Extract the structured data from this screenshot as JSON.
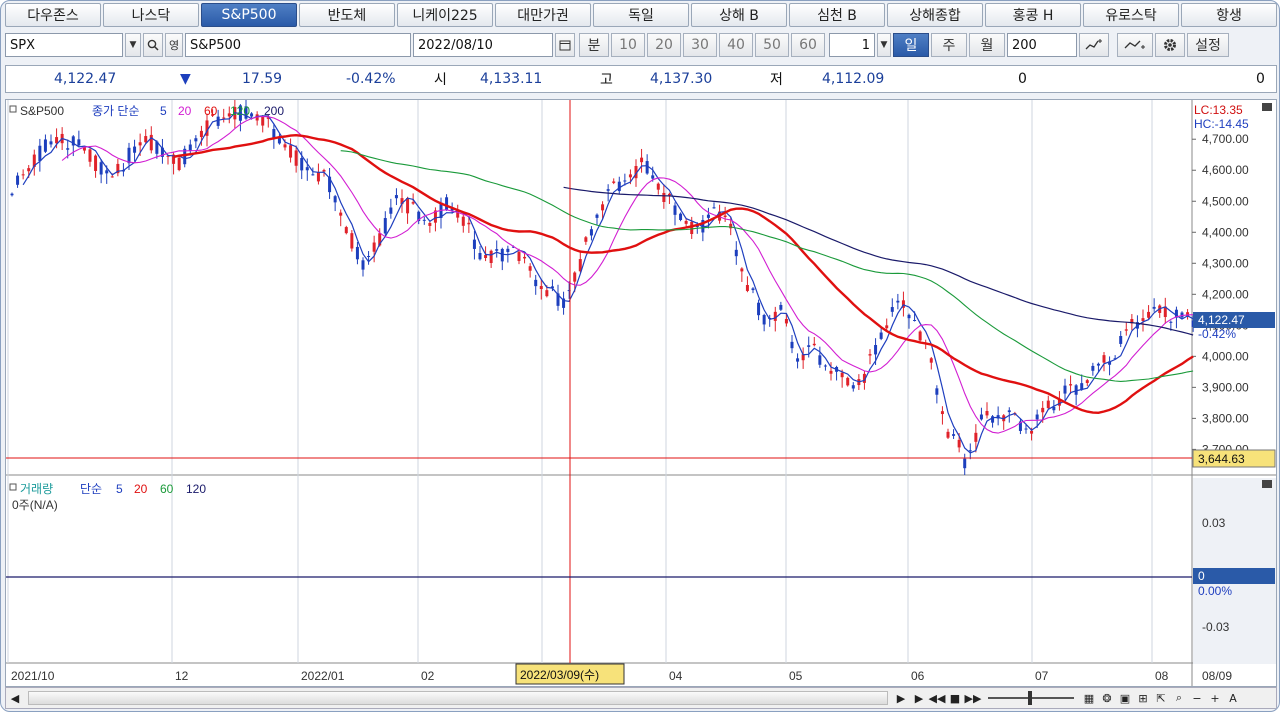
{
  "tabs": [
    {
      "label": "다우존스"
    },
    {
      "label": "나스닥"
    },
    {
      "label": "S&P500",
      "active": true
    },
    {
      "label": "반도체"
    },
    {
      "label": "니케이225"
    },
    {
      "label": "대만가권"
    },
    {
      "label": "독일"
    },
    {
      "label": "상해 B"
    },
    {
      "label": "심천 B"
    },
    {
      "label": "상해종합"
    },
    {
      "label": "홍콩 H"
    },
    {
      "label": "유로스탁"
    },
    {
      "label": "항생"
    }
  ],
  "toolbar": {
    "symbol": "SPX",
    "name": "S&P500",
    "date": "2022/08/10",
    "minute_label": "분",
    "minute_options": [
      "10",
      "20",
      "30",
      "40",
      "50",
      "60"
    ],
    "unit_value": "1",
    "day_label": "일",
    "week_label": "주",
    "month_label": "월",
    "count_value": "200",
    "settings_label": "설정",
    "period_icon": "영"
  },
  "quote": {
    "last": "4,122.47",
    "change_dir": "▼",
    "change": "17.59",
    "change_pct": "-0.42%",
    "open_label": "시",
    "open": "4,133.11",
    "high_label": "고",
    "high": "4,137.30",
    "low_label": "저",
    "low": "4,112.09",
    "volume": "0",
    "amount": "0"
  },
  "price_panel": {
    "legend_name": "S&P500",
    "legend_type": "종가 단순",
    "ma": [
      {
        "period": "5",
        "color": "#1f3fbf"
      },
      {
        "period": "20",
        "color": "#d21fd2"
      },
      {
        "period": "60",
        "color": "#e01010"
      },
      {
        "period": "120",
        "color": "#1a9a3a"
      },
      {
        "period": "200",
        "color": "#1a1a6a"
      }
    ],
    "lc": "LC:13.35",
    "hc": "HC:-14.45",
    "last_tag": "4,122.47",
    "last_pct": "-0.42%",
    "low_tag": "3,644.63"
  },
  "volume_panel": {
    "legend_name": "거래량",
    "legend_type": "단순",
    "ma": [
      {
        "period": "5",
        "color": "#1f3fbf"
      },
      {
        "period": "20",
        "color": "#e01010"
      },
      {
        "period": "60",
        "color": "#1a9a3a"
      },
      {
        "period": "120",
        "color": "#1a1a6a"
      }
    ],
    "status": "0주(N/A)",
    "tag_value": "0",
    "tag_pct": "0.00%"
  },
  "crosshair_date": "2022/03/09(수)",
  "right_date": "08/09",
  "colors": {
    "up": "#e0222a",
    "down": "#1d3fbd",
    "accent": "#2a5aa8"
  },
  "chart_data": [
    {
      "type": "candlestick",
      "y_ticks": [
        "4,700.00",
        "4,600.00",
        "4,500.00",
        "4,400.00",
        "4,300.00",
        "4,200.00",
        "4,100.00",
        "4,000.00",
        "3,900.00",
        "3,800.00",
        "3,700.00"
      ],
      "ylim": [
        3640,
        4820
      ],
      "x_ticks": [
        "2021/10",
        "12",
        "2022/01",
        "02",
        "03",
        "04",
        "05",
        "06",
        "07",
        "08"
      ],
      "series": [
        {
          "name": "종가",
          "close_path": [
            4550,
            4600,
            4680,
            4700,
            4690,
            4620,
            4580,
            4650,
            4700,
            4660,
            4620,
            4700,
            4750,
            4780,
            4790,
            4760,
            4700,
            4640,
            4590,
            4560,
            4410,
            4300,
            4380,
            4520,
            4470,
            4430,
            4500,
            4440,
            4330,
            4320,
            4360,
            4260,
            4210,
            4180,
            4300,
            4460,
            4540,
            4590,
            4620,
            4520,
            4460,
            4400,
            4490,
            4400,
            4230,
            4130,
            4140,
            4000,
            4020,
            3960,
            3900,
            3940,
            4080,
            4160,
            4130,
            3970,
            3760,
            3670,
            3790,
            3820,
            3800,
            3770,
            3830,
            3880,
            3920,
            3960,
            4010,
            4100,
            4150,
            4130,
            4122
          ]
        },
        {
          "name": "5"
        },
        {
          "name": "20"
        },
        {
          "name": "60"
        },
        {
          "name": "120"
        },
        {
          "name": "200"
        }
      ]
    },
    {
      "type": "bar",
      "y_ticks": [
        "0.03",
        "0",
        "-0.03"
      ],
      "series": [
        {
          "name": "거래량",
          "values": [
            0
          ]
        }
      ]
    }
  ]
}
